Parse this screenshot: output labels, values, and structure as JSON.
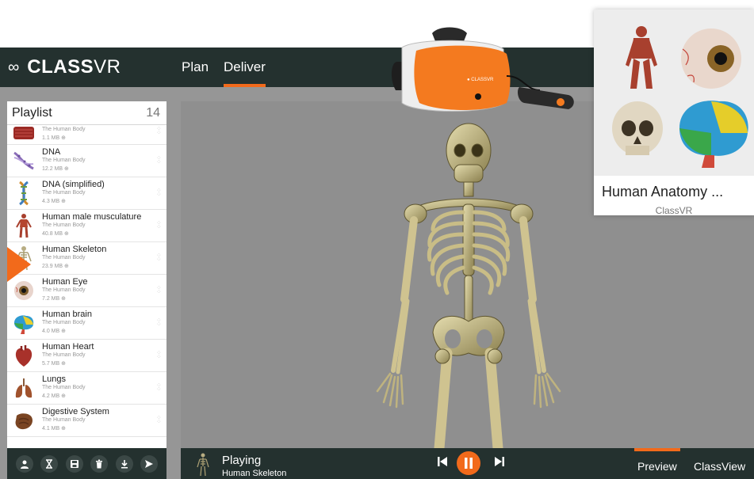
{
  "header": {
    "logo_bold": "CLASS",
    "logo_light": "VR",
    "tabs": [
      {
        "label": "Plan",
        "active": false
      },
      {
        "label": "Deliver",
        "active": true
      }
    ]
  },
  "playlist": {
    "title": "Playlist",
    "count": "14",
    "items": [
      {
        "name": "",
        "subtitle": "The Human Body",
        "size": "1.1 MB",
        "icon": "muscle-icon"
      },
      {
        "name": "DNA",
        "subtitle": "The Human Body",
        "size": "12.2 MB",
        "icon": "dna-icon"
      },
      {
        "name": "DNA (simplified)",
        "subtitle": "The Human Body",
        "size": "4.3 MB",
        "icon": "dna-simplified-icon"
      },
      {
        "name": "Human male musculature",
        "subtitle": "The Human Body",
        "size": "40.8 MB",
        "icon": "musculature-icon"
      },
      {
        "name": "Human Skeleton",
        "subtitle": "The Human Body",
        "size": "23.9 MB",
        "icon": "skeleton-icon",
        "playing": true
      },
      {
        "name": "Human Eye",
        "subtitle": "The Human Body",
        "size": "7.2 MB",
        "icon": "eye-icon"
      },
      {
        "name": "Human brain",
        "subtitle": "The Human Body",
        "size": "4.0 MB",
        "icon": "brain-icon"
      },
      {
        "name": "Human Heart",
        "subtitle": "The Human Body",
        "size": "5.7 MB",
        "icon": "heart-icon"
      },
      {
        "name": "Lungs",
        "subtitle": "The Human Body",
        "size": "4.2 MB",
        "icon": "lungs-icon"
      },
      {
        "name": "Digestive System",
        "subtitle": "The Human Body",
        "size": "4.1 MB",
        "icon": "digestive-icon"
      }
    ],
    "toolbar": [
      "user-icon",
      "hourglass-icon",
      "save-icon",
      "trash-icon",
      "download-icon",
      "send-icon"
    ]
  },
  "player": {
    "status": "Playing",
    "title": "Human Skeleton",
    "tabs": [
      {
        "label": "Preview",
        "active": true
      },
      {
        "label": "ClassView",
        "active": false
      }
    ]
  },
  "card": {
    "title": "Human Anatomy ...",
    "subtitle": "ClassVR"
  },
  "colors": {
    "accent": "#f26a1b",
    "bar": "#24312f",
    "viewer_bg": "#8f8f8f"
  }
}
